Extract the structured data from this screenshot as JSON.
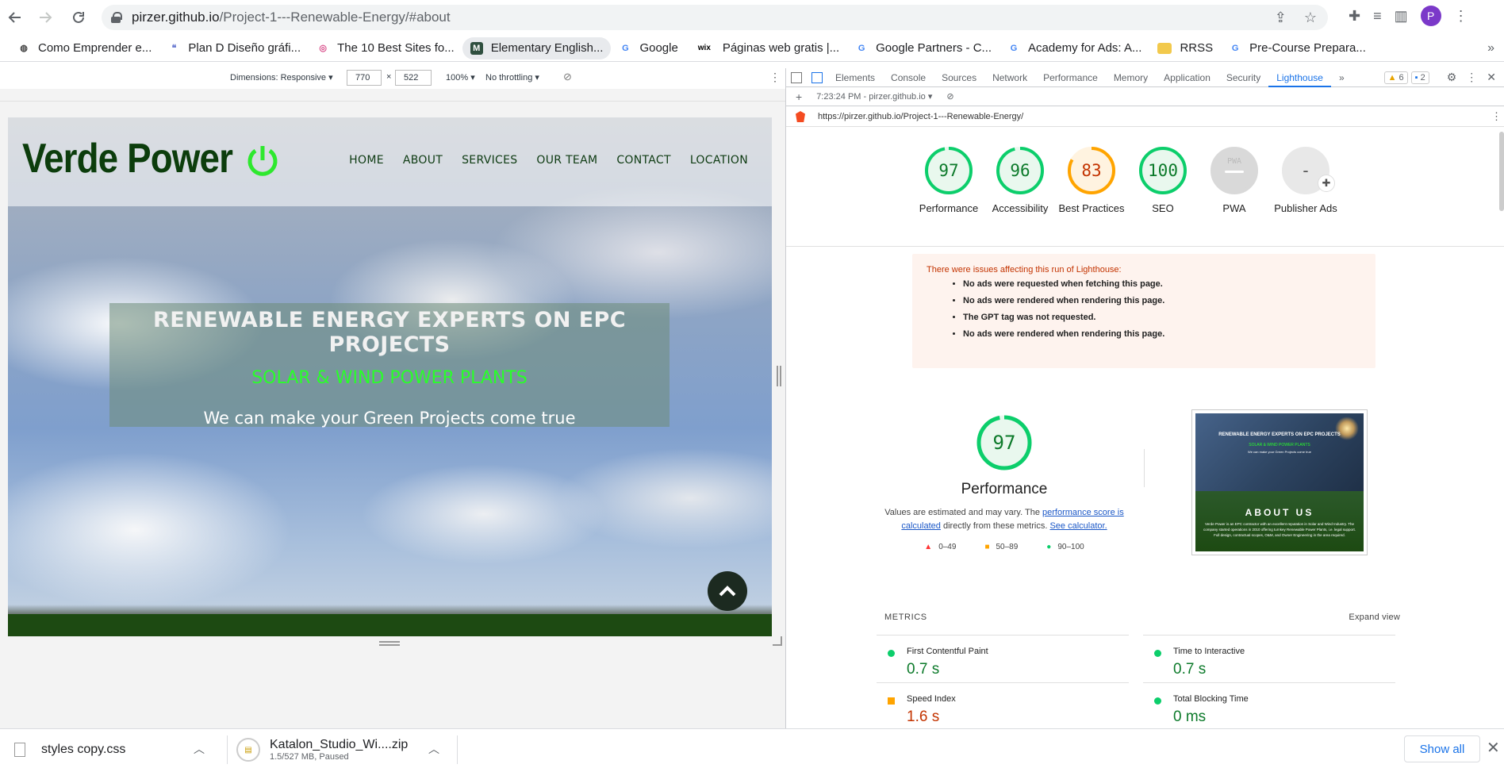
{
  "browser": {
    "url_host": "pirzer.github.io",
    "url_path": "/Project-1---Renewable-Energy/#about",
    "avatar_letter": "P",
    "bookmarks": [
      {
        "label": "Como Emprender e...",
        "icon": "emprender-icon"
      },
      {
        "label": "Plan D Diseño gráfi...",
        "icon": "quote-icon"
      },
      {
        "label": "The 10 Best Sites fo...",
        "icon": "swirl-icon"
      },
      {
        "label": "Elementary English...",
        "icon": "m-icon"
      },
      {
        "label": "Google",
        "icon": "google-icon"
      },
      {
        "label": "Páginas web gratis |...",
        "icon": "wix-icon"
      },
      {
        "label": "Google Partners - C...",
        "icon": "google-icon"
      },
      {
        "label": "Academy for Ads: A...",
        "icon": "google-icon"
      },
      {
        "label": "RRSS",
        "icon": "folder-icon"
      },
      {
        "label": "Pre-Course Prepara...",
        "icon": "google-icon"
      }
    ]
  },
  "device_toolbar": {
    "dimensions_label": "Dimensions: Responsive ▾",
    "width": "770",
    "times": "×",
    "height": "522",
    "zoom": "100% ▾",
    "throttling": "No throttling ▾"
  },
  "site": {
    "logo": "Verde Power",
    "nav": [
      "HOME",
      "ABOUT",
      "SERVICES",
      "OUR TEAM",
      "CONTACT",
      "LOCATION"
    ],
    "hero_title": "RENEWABLE ENERGY EXPERTS ON EPC PROJECTS",
    "hero_sub": "SOLAR & WIND POWER PLANTS",
    "hero_tag": "We can make your Green Projects come true"
  },
  "devtools": {
    "tabs": [
      "Elements",
      "Console",
      "Sources",
      "Network",
      "Performance",
      "Memory",
      "Application",
      "Security",
      "Lighthouse"
    ],
    "more": "»",
    "warnings_count": "6",
    "messages_count": "2",
    "report_time": "7:23:24 PM - pirzer.github.io ▾",
    "audited_url": "https://pirzer.github.io/Project-1---Renewable-Energy/",
    "scores": [
      {
        "label": "Performance",
        "value": "97",
        "fraction": 0.97,
        "color": "#0cce6b",
        "text_color": "#0c7a2a"
      },
      {
        "label": "Accessibility",
        "value": "96",
        "fraction": 0.96,
        "color": "#0cce6b",
        "text_color": "#0c7a2a"
      },
      {
        "label": "Best Practices",
        "value": "83",
        "fraction": 0.83,
        "color": "#ffa400",
        "text_color": "#c33300"
      },
      {
        "label": "SEO",
        "value": "100",
        "fraction": 1.0,
        "color": "#0cce6b",
        "text_color": "#0c7a2a"
      },
      {
        "label": "PWA",
        "value": "PWA",
        "fraction": 0,
        "color": "#d9d9d9",
        "text_color": "#bbbbbb"
      },
      {
        "label": "Publisher Ads",
        "value": "-",
        "fraction": 0,
        "color": "#e8e8e8",
        "text_color": "#555555"
      }
    ],
    "warning_title": "There were issues affecting this run of Lighthouse:",
    "warnings": [
      "No ads were requested when fetching this page.",
      "No ads were rendered when rendering this page.",
      "The GPT tag was not requested.",
      "No ads were rendered when rendering this page."
    ],
    "perf_score": "97",
    "perf_title": "Performance",
    "perf_desc_1": "Values are estimated and may vary. The ",
    "perf_link_1": "performance score is calculated",
    "perf_desc_2": " directly from these metrics. ",
    "perf_link_2": "See calculator.",
    "legend": [
      "0–49",
      "50–89",
      "90–100"
    ],
    "screenshot": {
      "title": "RENEWABLE ENERGY EXPERTS ON EPC PROJECTS",
      "sub": "SOLAR & WIND POWER PLANTS",
      "tag": "We can make your Green Projects come true",
      "about": "ABOUT US",
      "about_text": "Verde Power is an EPC contractor with an excellent reputation in Solar and Wind Industry. The company started operations in 2010 offering turnkey Renewable Power Plants, i.e. legal support. Full design, contractual scopes, O&M, and Owner Engineering in the area required."
    },
    "metrics_label": "METRICS",
    "expand_view": "Expand view",
    "metrics": [
      {
        "label": "First Contentful Paint",
        "value": "0.7 s",
        "status": "good"
      },
      {
        "label": "Time to Interactive",
        "value": "0.7 s",
        "status": "good"
      },
      {
        "label": "Speed Index",
        "value": "1.6 s",
        "status": "average"
      },
      {
        "label": "Total Blocking Time",
        "value": "0 ms",
        "status": "good"
      }
    ]
  },
  "downloads": {
    "item1_name": "styles copy.css",
    "item2_name": "Katalon_Studio_Wi....zip",
    "item2_status": "1.5/527 MB, Paused",
    "show_all": "Show all"
  }
}
